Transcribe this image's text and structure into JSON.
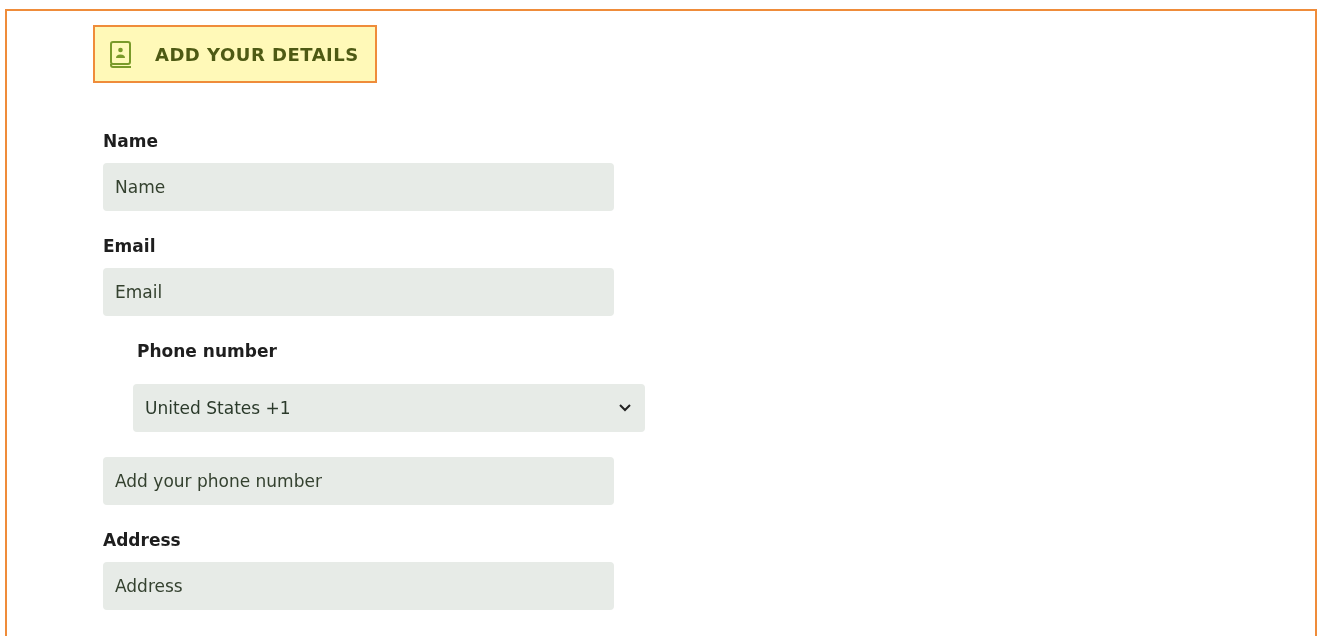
{
  "header": {
    "title": "ADD YOUR DETAILS"
  },
  "fields": [
    {
      "kind": "text",
      "label": "Name",
      "placeholder": "Name"
    },
    {
      "kind": "text",
      "label": "Email",
      "placeholder": "Email"
    },
    {
      "kind": "phone",
      "label": "Phone number",
      "country": "United States +1",
      "placeholder": "Add your phone number"
    },
    {
      "kind": "text",
      "label": "Address",
      "placeholder": "Address"
    }
  ]
}
